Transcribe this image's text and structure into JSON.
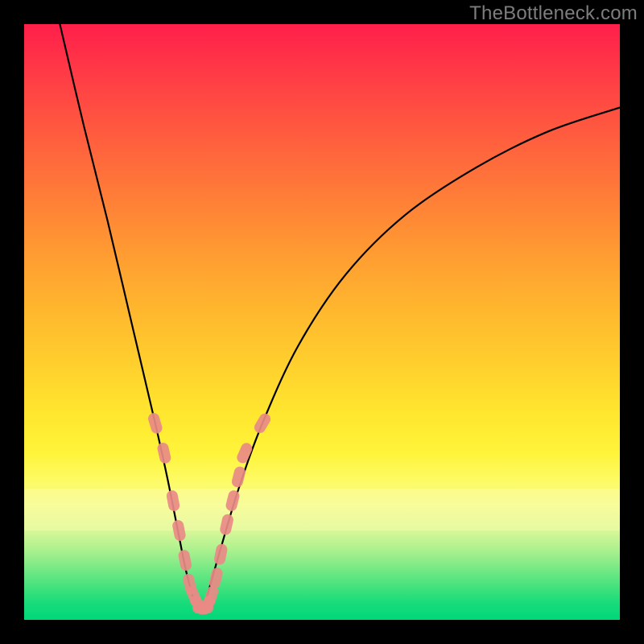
{
  "watermark": "TheBottleneck.com",
  "chart_data": {
    "type": "line",
    "title": "",
    "xlabel": "",
    "ylabel": "",
    "xlim": [
      0,
      100
    ],
    "ylim": [
      0,
      100
    ],
    "series": [
      {
        "name": "bottleneck-curve",
        "x": [
          6,
          10,
          14,
          18,
          22,
          24,
          26,
          27,
          28,
          29,
          30,
          31,
          33,
          36,
          40,
          46,
          54,
          64,
          76,
          88,
          100
        ],
        "y": [
          100,
          83,
          67,
          50,
          33,
          24,
          14,
          9,
          5,
          2,
          2,
          5,
          12,
          22,
          33,
          46,
          58,
          68,
          76,
          82,
          86
        ]
      }
    ],
    "markers": {
      "name": "highlight-points",
      "note": "salmon capsule markers along lower part of curve",
      "x": [
        22,
        23.5,
        25,
        26,
        27,
        27.8,
        28.5,
        29.3,
        30,
        30.7,
        31.4,
        32.2,
        33,
        34,
        35,
        36,
        37,
        40
      ],
      "y": [
        33,
        28,
        20,
        15,
        10,
        6,
        4,
        2.5,
        2,
        2.5,
        4,
        7,
        11,
        16,
        20,
        24,
        28,
        33
      ]
    },
    "background_gradient": {
      "top_color": "#ff1f4b",
      "mid_color": "#ffe82f",
      "bottom_color": "#00d77a"
    }
  }
}
